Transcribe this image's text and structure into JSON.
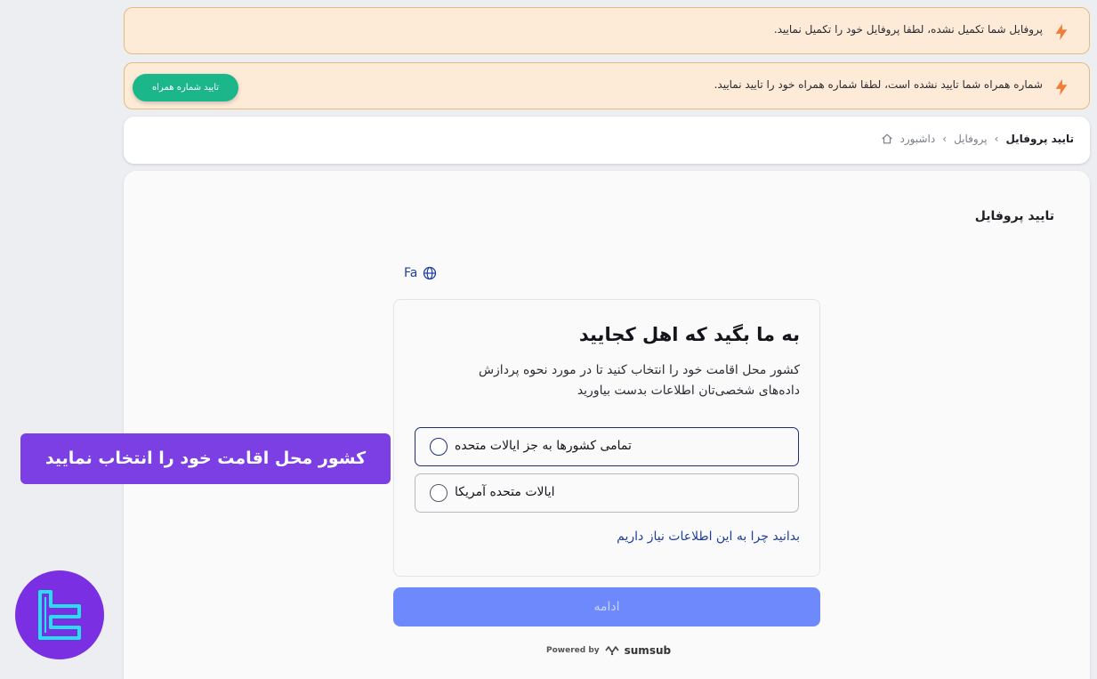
{
  "alerts": [
    {
      "message": "پروفایل شما تکمیل نشده، لطفا پروفایل خود را تکمیل نمایید.",
      "icon": "bolt-icon"
    },
    {
      "message": "شماره همراه شما تایید نشده است، لطفا شماره همراه خود را تایید نمایید.",
      "icon": "bolt-icon",
      "button": "تایید شماره همراه"
    }
  ],
  "breadcrumb": {
    "home": "داشبورد",
    "middle": "پروفایل",
    "current": "تایید پروفایل",
    "separator": "›"
  },
  "main": {
    "title": "تایید پروفایل"
  },
  "verification": {
    "language": "Fa",
    "heading": "به ما بگید که اهل کجایید",
    "description": "کشور محل اقامت خود را انتخاب کنید تا در مورد نحوه پردازش داده‌های شخصی‌تان اطلاعات بدست بیاورید",
    "options": [
      {
        "label": "تمامی کشورها به جز ایالات متحده"
      },
      {
        "label": "ایالات متحده آمریکا"
      }
    ],
    "why_link": "بدانید چرا به این اطلاعات نیاز داریم",
    "continue": "ادامه",
    "powered_by": "Powered by",
    "provider": "sumsub"
  },
  "overlay": {
    "banner": "کشور محل اقامت خود را انتخاب نمایید"
  },
  "colors": {
    "alert_bg": "#fdebd8",
    "alert_button": "#1bb78b",
    "continue_button": "#6e89fb",
    "banner": "#7c3fe4",
    "link": "#1f3f9e"
  }
}
